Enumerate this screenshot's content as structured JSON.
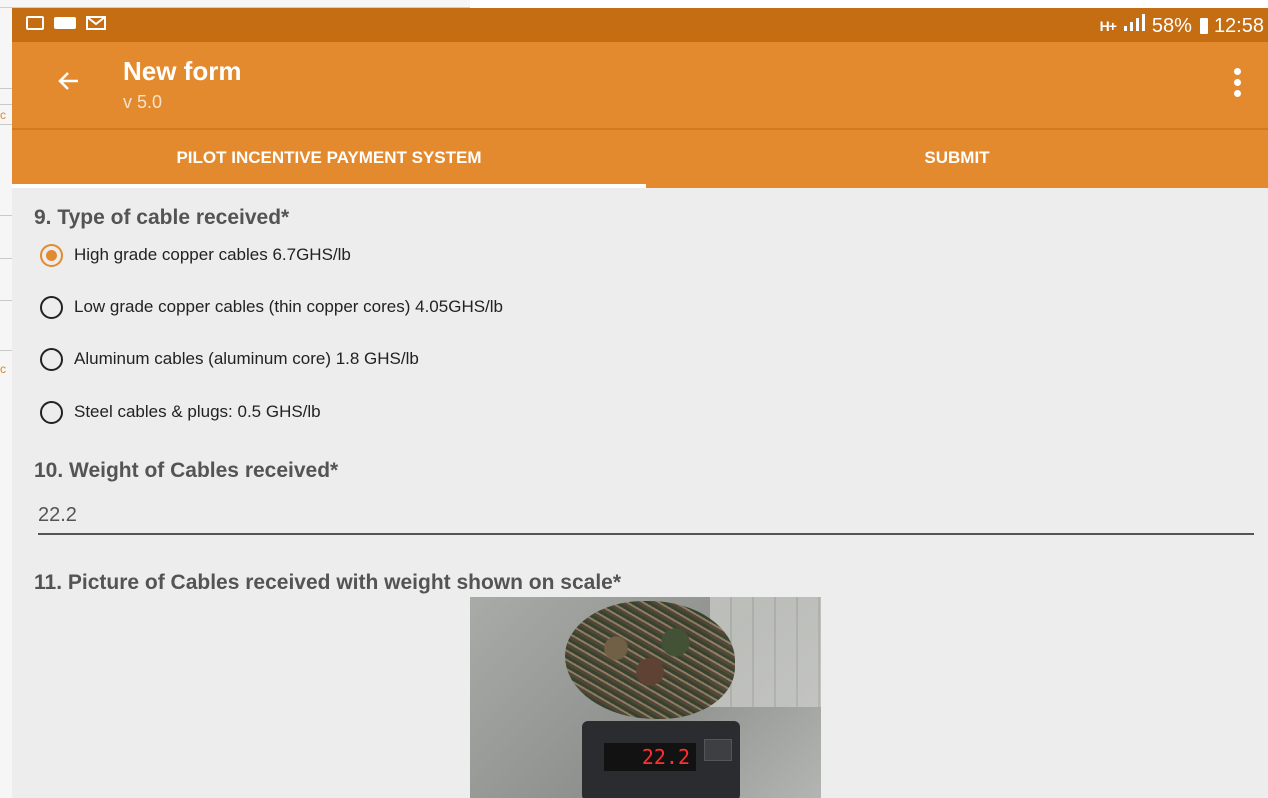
{
  "status_bar": {
    "network": "H+",
    "battery": "58%",
    "time": "12:58",
    "icons": [
      "gallery-icon",
      "app-icon",
      "mail-icon"
    ]
  },
  "app_bar": {
    "title": "New form",
    "version": "v 5.0",
    "color": "#e48a2e"
  },
  "tabs": [
    {
      "label": "PILOT INCENTIVE PAYMENT SYSTEM",
      "selected": true
    },
    {
      "label": "SUBMIT",
      "selected": false
    }
  ],
  "questions": {
    "q9": {
      "label": "9. Type of cable received*",
      "options": [
        {
          "label": "High grade copper cables 6.7GHS/lb",
          "selected": true
        },
        {
          "label": "Low grade copper cables (thin copper cores) 4.05GHS/lb",
          "selected": false
        },
        {
          "label": "Aluminum cables (aluminum core) 1.8 GHS/lb",
          "selected": false
        },
        {
          "label": "Steel cables & plugs: 0.5 GHS/lb",
          "selected": false
        }
      ]
    },
    "q10": {
      "label": "10. Weight of Cables received*",
      "value": "22.2"
    },
    "q11": {
      "label": "11. Picture of Cables received with weight shown on scale*",
      "scale_reading": "22.2"
    }
  }
}
